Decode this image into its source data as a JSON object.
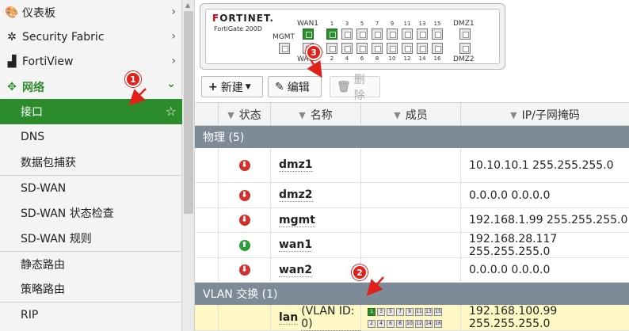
{
  "sidebar": {
    "items": [
      {
        "label": "仪表板",
        "icon": "dashboard-icon",
        "glyph": "🎨",
        "chevron": "›"
      },
      {
        "label": "Security Fabric",
        "icon": "security-fabric-icon",
        "glyph": "✲",
        "chevron": "›"
      },
      {
        "label": "FortiView",
        "icon": "fortiview-chart-icon",
        "glyph": "▟",
        "chevron": "›"
      },
      {
        "label": "网络",
        "icon": "network-move-icon",
        "glyph": "✥",
        "chevron": "⌄"
      },
      {
        "label": "接口",
        "star": "☆"
      },
      {
        "label": "DNS"
      },
      {
        "label": "数据包捕获"
      },
      {
        "label": "SD-WAN"
      },
      {
        "label": "SD-WAN 状态检查"
      },
      {
        "label": "SD-WAN 规则"
      },
      {
        "label": "静态路由"
      },
      {
        "label": "策略路由"
      },
      {
        "label": "RIP"
      }
    ]
  },
  "device": {
    "brand_red": "F",
    "brand_rest": "ORTINET.",
    "model": "FortiGate 200D",
    "labels": {
      "mgmt": "MGMT",
      "wan1": "WAN1",
      "wan2": "WA",
      "dmz1": "DMZ1",
      "dmz2": "DMZ2"
    },
    "top_ports": [
      "1",
      "3",
      "5",
      "7",
      "9",
      "11",
      "13",
      "15"
    ],
    "bottom_ports": [
      "2",
      "4",
      "6",
      "8",
      "10",
      "12",
      "14",
      "16"
    ]
  },
  "toolbar": {
    "new_label": "新建",
    "edit_label": "编辑",
    "delete_label": "删除"
  },
  "table": {
    "headers": {
      "status": "状态",
      "name": "名称",
      "members": "成员",
      "ip": "IP/子网掩码"
    },
    "groups": [
      {
        "label": "物理 (5)",
        "rows": [
          {
            "status": "down",
            "name": "dmz1",
            "ip": "10.10.10.1 255.255.255.0"
          },
          {
            "status": "down",
            "name": "dmz2",
            "ip": "0.0.0.0 0.0.0.0"
          },
          {
            "status": "down",
            "name": "mgmt",
            "ip": "192.168.1.99 255.255.255.0"
          },
          {
            "status": "up",
            "name": "wan1",
            "ip": "192.168.28.117 255.255.255.0"
          },
          {
            "status": "down",
            "name": "wan2",
            "ip": "0.0.0.0 0.0.0.0"
          }
        ]
      },
      {
        "label": "VLAN 交换 (1)",
        "rows": [
          {
            "name": "lan",
            "extra": "(VLAN ID: 0)",
            "ip": "192.168.100.99 255.255.255.0",
            "member_ports_top": [
              "1",
              "3",
              "5",
              "7",
              "9",
              "11",
              "13",
              "15"
            ],
            "member_ports_bottom": [
              "2",
              "4",
              "6",
              "8",
              "10",
              "12",
              "14",
              "16"
            ]
          }
        ]
      }
    ]
  },
  "annotations": {
    "badge1": "1",
    "badge2": "2",
    "badge3": "3"
  },
  "colors": {
    "accent_green": "#2c8c2c",
    "group_header": "#7d8b99",
    "highlight_row": "#fdf8c4",
    "annotation_red": "#e0211a"
  }
}
